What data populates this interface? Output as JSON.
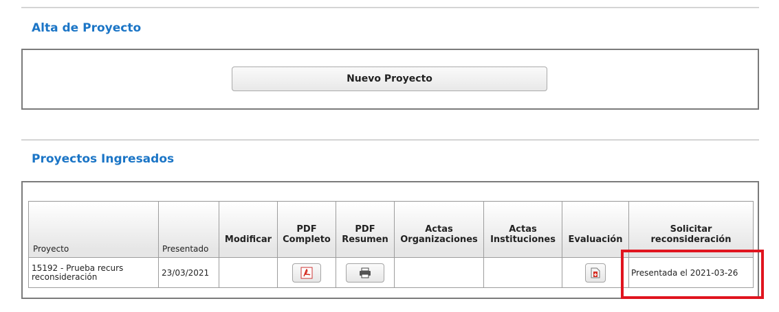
{
  "sections": {
    "alta_title": "Alta de Proyecto",
    "ingresados_title": "Proyectos Ingresados"
  },
  "alta": {
    "new_project_label": "Nuevo Proyecto"
  },
  "table": {
    "headers": {
      "proyecto": "Proyecto",
      "presentado": "Presentado",
      "modificar": "Modificar",
      "pdf_completo_1": "PDF",
      "pdf_completo_2": "Completo",
      "pdf_resumen_1": "PDF",
      "pdf_resumen_2": "Resumen",
      "actas_org_1": "Actas",
      "actas_org_2": "Organizaciones",
      "actas_inst_1": "Actas",
      "actas_inst_2": "Instituciones",
      "evaluacion": "Evaluación",
      "solicitar_1": "Solicitar",
      "solicitar_2": "reconsideración"
    },
    "rows": [
      {
        "proyecto_line1": "15192 - Prueba recurs",
        "proyecto_line2": "reconsideración",
        "presentado": "23/03/2021",
        "reconsideracion": "Presentada el 2021-03-26"
      }
    ]
  },
  "icons": {
    "pdf_completo": "pdf-icon",
    "pdf_resumen": "printer-icon",
    "evaluacion": "download-icon"
  },
  "colors": {
    "title": "#1b75c6",
    "highlight": "#e0141e",
    "pdf_red": "#d52a1f"
  }
}
